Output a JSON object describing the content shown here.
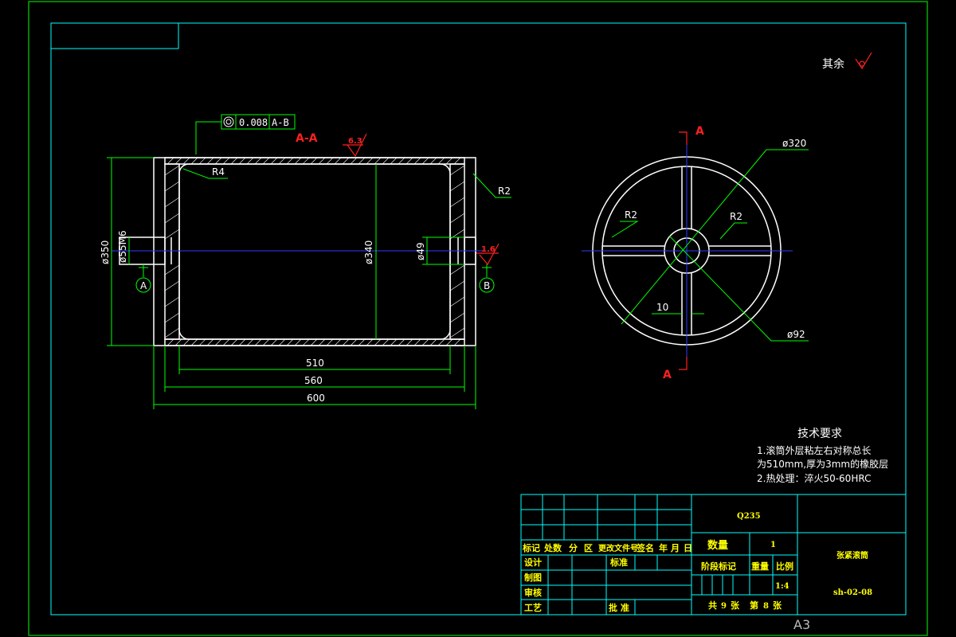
{
  "surface_finish_note": {
    "label": "其余"
  },
  "section_view": {
    "label": "A-A",
    "roughness_top": "6.3",
    "roughness_right": "1.6",
    "tolerance_frame": {
      "value": "0.008",
      "datum": "A-B"
    },
    "dimensions": {
      "radius_inner": "R4",
      "radius_outer": "R2",
      "dia_outer": "ø350",
      "dia_shaft": "ø55M6",
      "dia_inner": "ø340",
      "dia_bore": "ø49",
      "len_510": "510",
      "len_560": "560",
      "len_600": "600"
    },
    "datums": [
      "A",
      "B"
    ]
  },
  "end_view": {
    "section_label": "A",
    "dimensions": {
      "dia_rim": "ø320",
      "radius_left": "R2",
      "radius_right": "R2",
      "spoke_width": "10",
      "dia_hub": "ø92"
    }
  },
  "technical_requirements": {
    "title": "技术要求",
    "lines": [
      "1.滚筒外层粘左右对称总长",
      "为510mm,厚为3mm的橡胶层",
      "2.热处理：淬火50-60HRC"
    ]
  },
  "title_block": {
    "material": "Q235",
    "quantity_label": "数量",
    "quantity_value": "1",
    "part_name": "张紧滚筒",
    "drawing_number": "sh-02-08",
    "header": [
      "标记",
      "处数",
      "分",
      "区",
      "更改文件号",
      "签名",
      "年",
      "月",
      "日"
    ],
    "rows": {
      "design": "设计",
      "standard": "标准",
      "draw": "制图",
      "review": "审核",
      "process": "工艺",
      "approve": "批 准"
    },
    "stage_label": "阶段标记",
    "weight_label": "重量",
    "scale_label": "比例",
    "scale_value": "1:4",
    "sheets_total_prefix": "共",
    "sheets_total": "9",
    "sheets_total_suffix": "张",
    "sheet_no_prefix": "第",
    "sheet_no": "8",
    "sheet_no_suffix": "张"
  },
  "paper_size": "A3"
}
